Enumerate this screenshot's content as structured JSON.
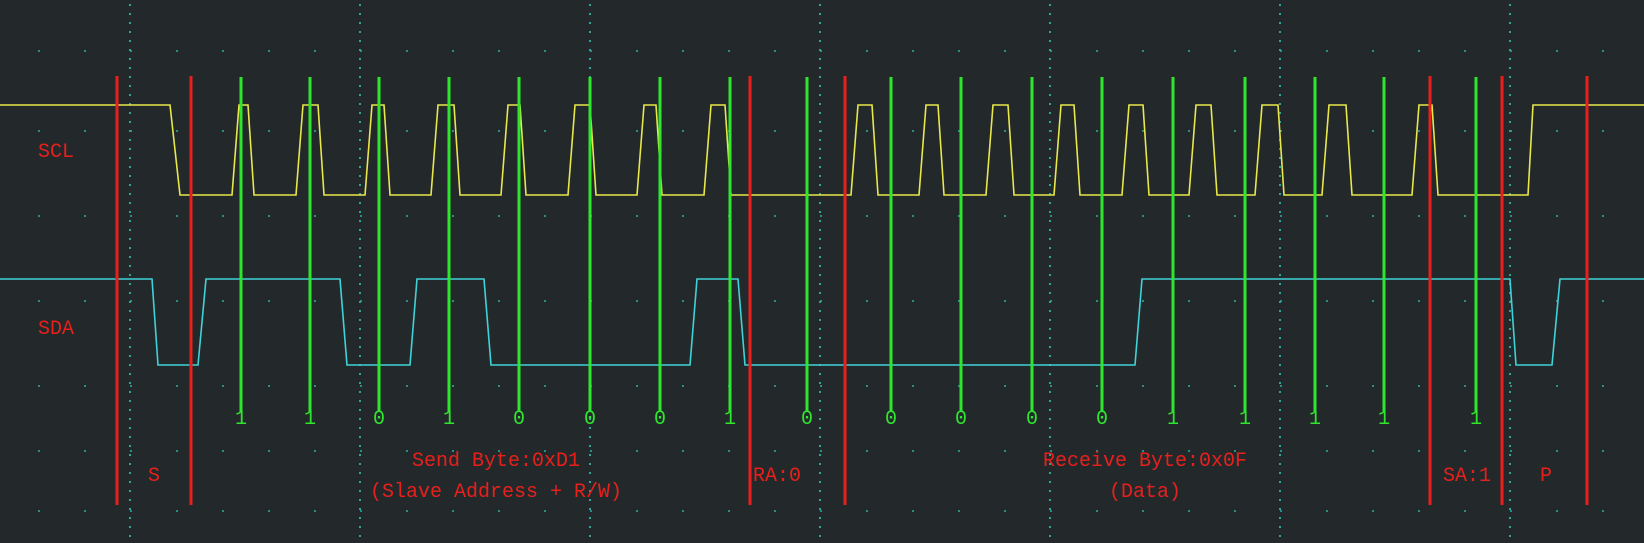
{
  "signals": {
    "scl_label": "SCL",
    "sda_label": "SDA"
  },
  "colors": {
    "background": "#23292b",
    "scl_trace": "#e8e84a",
    "sda_trace": "#3fd2d8",
    "marker_red": "#e8201c",
    "marker_green": "#2ee62e",
    "grid_dots": "#2fa59a"
  },
  "bits": [
    {
      "value": "1"
    },
    {
      "value": "1"
    },
    {
      "value": "0"
    },
    {
      "value": "1"
    },
    {
      "value": "0"
    },
    {
      "value": "0"
    },
    {
      "value": "0"
    },
    {
      "value": "1"
    },
    {
      "value": "0"
    },
    {
      "value": "0"
    },
    {
      "value": "0"
    },
    {
      "value": "0"
    },
    {
      "value": "0"
    },
    {
      "value": "1"
    },
    {
      "value": "1"
    },
    {
      "value": "1"
    },
    {
      "value": "1"
    },
    {
      "value": "1"
    }
  ],
  "segments": {
    "start": "S",
    "send_line1": "Send Byte:0xD1",
    "send_line2": "(Slave Address + R/W)",
    "read_ack": "RA:0",
    "receive_line1": "Receive Byte:0x0F",
    "receive_line2": "(Data)",
    "send_ack": "SA:1",
    "stop": "P"
  }
}
